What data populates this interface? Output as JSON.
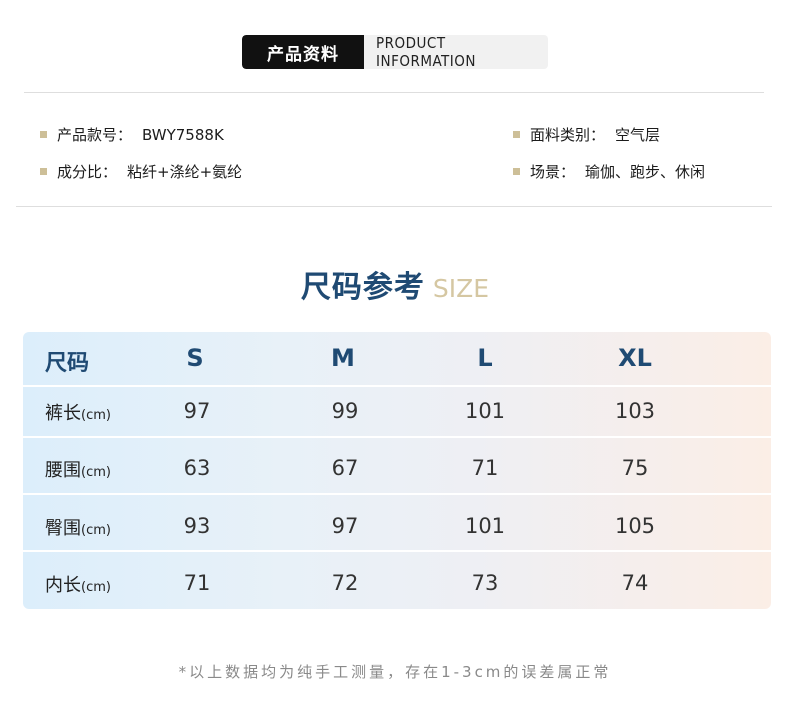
{
  "header": {
    "zh": "产品资料",
    "en": "PRODUCT INFORMATION"
  },
  "info": [
    {
      "label": "产品款号：",
      "value": "BWY7588K"
    },
    {
      "label": "面料类别：",
      "value": "空气层"
    },
    {
      "label": "成分比：",
      "value": "粘纤+涤纶+氨纶"
    },
    {
      "label": "场景：",
      "value": "瑜伽、跑步、休闲"
    }
  ],
  "size_section": {
    "title_zh": "尺码参考",
    "title_en": "SIZE"
  },
  "table": {
    "corner": "尺码",
    "sizes": [
      "S",
      "M",
      "L",
      "XL"
    ],
    "unit": "(cm)",
    "rows": [
      {
        "label": "裤长",
        "values": [
          "97",
          "99",
          "101",
          "103"
        ]
      },
      {
        "label": "腰围",
        "values": [
          "63",
          "67",
          "71",
          "75"
        ]
      },
      {
        "label": "臀围",
        "values": [
          "93",
          "97",
          "101",
          "105"
        ]
      },
      {
        "label": "内长",
        "values": [
          "71",
          "72",
          "73",
          "74"
        ]
      }
    ]
  },
  "note": "*以上数据均为纯手工测量，存在1-3cm的误差属正常",
  "colors": {
    "title_blue": "#1f4a73",
    "accent_gold": "#cdbf98"
  }
}
